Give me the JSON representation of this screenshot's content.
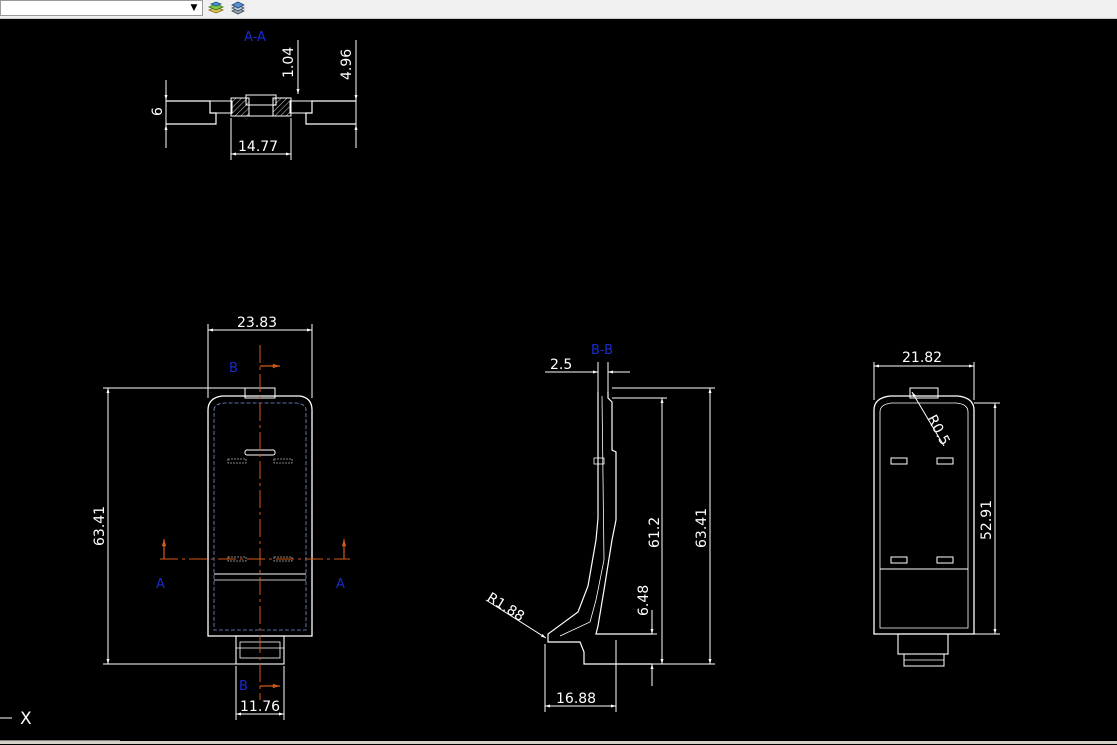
{
  "toolbar": {
    "layer_combo_value": "",
    "icons": [
      "layer-states-icon",
      "layer-previous-icon"
    ]
  },
  "colors": {
    "background": "#000000",
    "lines": "#ffffff",
    "section_labels": "#1a2bd0",
    "cut_lines": "#d25a1a"
  },
  "section_aa": {
    "title": "A-A",
    "dim_height": "6",
    "dim_wall": "1.04",
    "dim_total": "4.96",
    "dim_width": "14.77"
  },
  "front_view": {
    "dim_width": "23.83",
    "dim_height": "63.41",
    "dim_tab": "11.76",
    "cut_label_b_top": "B",
    "cut_label_b_bottom": "B",
    "cut_label_a_left": "A",
    "cut_label_a_right": "A"
  },
  "section_bb": {
    "title": "B-B",
    "dim_thickness": "2.5",
    "dim_inner": "61.2",
    "dim_total": "63.41",
    "dim_step": "6.48",
    "dim_depth": "16.88",
    "dim_radius": "R1.88"
  },
  "back_view": {
    "dim_width": "21.82",
    "dim_radius": "R0.5",
    "dim_height": "52.91"
  },
  "ucs": {
    "axis_label": "X"
  }
}
